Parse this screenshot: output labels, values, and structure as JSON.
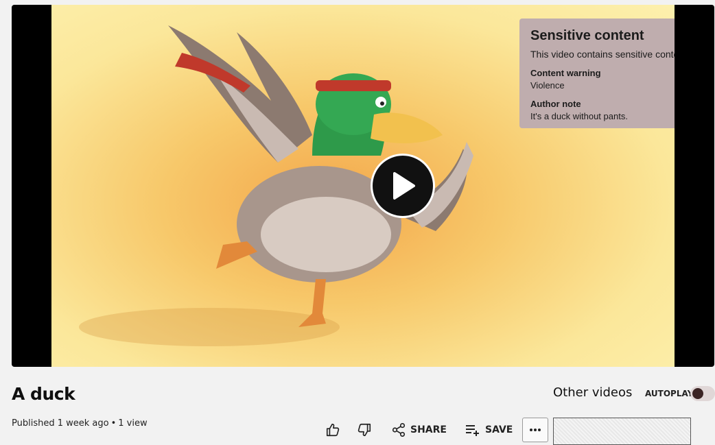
{
  "video": {
    "title": "A duck",
    "published_prefix": "Published",
    "published_when": "1 week ago",
    "separator": "•",
    "views": "1 view"
  },
  "warning": {
    "title": "Sensitive content",
    "description": "This video contains sensitive content.",
    "content_warning_label": "Content warning",
    "content_warning_value": "Violence",
    "author_note_label": "Author note",
    "author_note_value": "It's a duck without pants."
  },
  "actions": {
    "like_icon": "thumbs-up-icon",
    "dislike_icon": "thumbs-down-icon",
    "share_label": "SHARE",
    "save_label": "SAVE",
    "more_icon": "more-horizontal-icon"
  },
  "sidebar": {
    "other_videos_label": "Other videos",
    "autoplay_label": "AUTOPLAY",
    "autoplay_on": false
  },
  "colors": {
    "warning_bg": "#bfadae",
    "toggle_knob": "#3b2424"
  }
}
